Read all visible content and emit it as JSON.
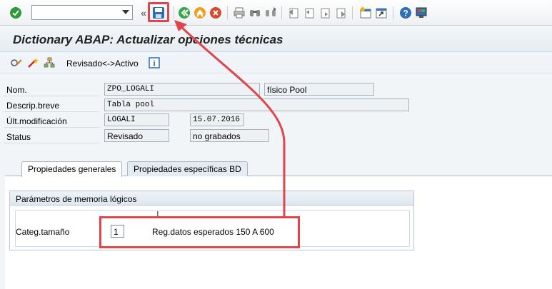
{
  "toolbar": {
    "command_field_value": "",
    "icons": [
      "ok-checkmark-icon",
      "command-dropdown-icon",
      "collapse-chevron-icon",
      "save-icon",
      "back-icon",
      "exit-icon",
      "cancel-icon",
      "print-icon",
      "find-icon",
      "find-next-icon",
      "first-page-icon",
      "prev-page-icon",
      "next-page-icon",
      "last-page-icon",
      "new-session-icon",
      "shortcut-icon",
      "help-icon",
      "layout-menu-icon"
    ],
    "collapse_glyph": "«"
  },
  "title": "Dictionary ABAP: Actualizar opciones técnicas",
  "app_toolbar": {
    "icons": [
      "display-change-icon",
      "wand-icon",
      "hierarchy-icon",
      "info-icon"
    ],
    "toggle_label": "Revisado<->Activo",
    "info_glyph": "i"
  },
  "fields": {
    "name_label": "Nom.",
    "name_value": "ZPO_LOGALI",
    "name_type": "físico Pool",
    "desc_label": "Descrip.breve",
    "desc_value": "Tabla pool",
    "mod_label": "Últ.modificación",
    "mod_user": "LOGALI",
    "mod_date": "15.07.2016",
    "status_label": "Status",
    "status_value": "Revisado",
    "status_save": "no grabados"
  },
  "tabs": [
    {
      "label": "Propiedades generales",
      "active": true
    },
    {
      "label": "Propiedades específicas BD",
      "active": false
    }
  ],
  "group": {
    "title": "Parámetros de memoria lógicos",
    "size_label": "Categ.tamaño",
    "size_value": "1",
    "size_text": "Reg.datos esperados 150 A 600"
  },
  "colors": {
    "highlight": "#e0454c",
    "ok_green": "#2e9a3a",
    "back_green": "#3aa54a",
    "exit_orange": "#f0a020",
    "cancel_red": "#d84a2e",
    "save_blue": "#2f6db4"
  }
}
